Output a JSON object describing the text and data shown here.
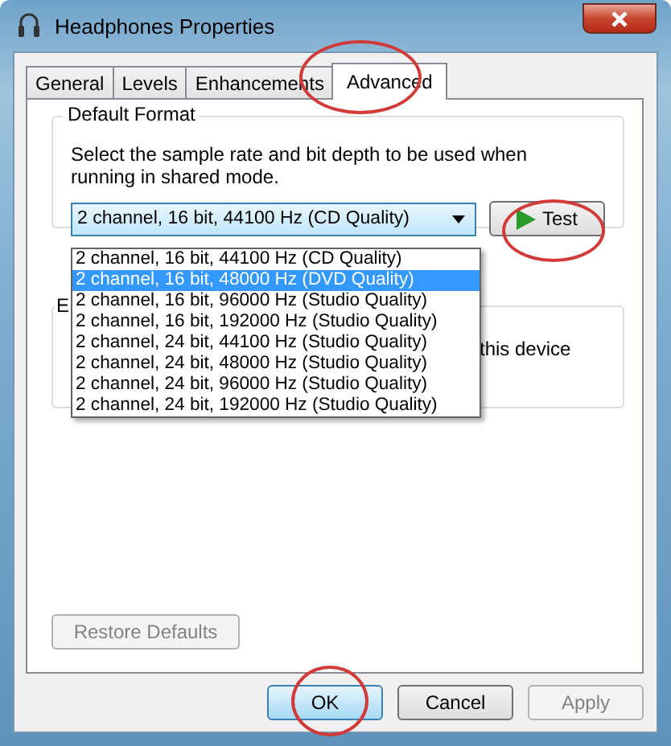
{
  "window": {
    "title": "Headphones Properties"
  },
  "tabs": [
    {
      "label": "General",
      "selected": false,
      "highlighted": false
    },
    {
      "label": "Levels",
      "selected": false,
      "highlighted": false
    },
    {
      "label": "Enhancements",
      "selected": false,
      "highlighted": false
    },
    {
      "label": "Advanced",
      "selected": true,
      "highlighted": true
    }
  ],
  "default_format": {
    "title": "Default Format",
    "description": "Select the sample rate and bit depth to be used when running in shared mode.",
    "value": "2 channel, 16 bit, 44100 Hz (CD Quality)",
    "expanded": true,
    "test_button": {
      "label": "Test",
      "highlighted": true
    },
    "options": [
      {
        "label": "2 channel, 16 bit, 44100 Hz (CD Quality)",
        "hovered": false
      },
      {
        "label": "2 channel, 16 bit, 48000 Hz (DVD Quality)",
        "hovered": true
      },
      {
        "label": "2 channel, 16 bit, 96000 Hz (Studio Quality)",
        "hovered": false
      },
      {
        "label": "2 channel, 16 bit, 192000 Hz (Studio Quality)",
        "hovered": false
      },
      {
        "label": "2 channel, 24 bit, 44100 Hz (Studio Quality)",
        "hovered": false
      },
      {
        "label": "2 channel, 24 bit, 48000 Hz (Studio Quality)",
        "hovered": false
      },
      {
        "label": "2 channel, 24 bit, 96000 Hz (Studio Quality)",
        "hovered": false
      },
      {
        "label": "2 channel, 24 bit, 192000 Hz (Studio Quality)",
        "hovered": false
      }
    ]
  },
  "exclusive_mode": {
    "title": "E",
    "text": "this device"
  },
  "restore_button": {
    "label": "Restore Defaults",
    "disabled": true
  },
  "buttons": [
    {
      "label": "OK",
      "default": true,
      "disabled": false,
      "highlighted": true
    },
    {
      "label": "Cancel",
      "default": false,
      "disabled": false,
      "highlighted": false
    },
    {
      "label": "Apply",
      "default": false,
      "disabled": true,
      "highlighted": false
    }
  ]
}
